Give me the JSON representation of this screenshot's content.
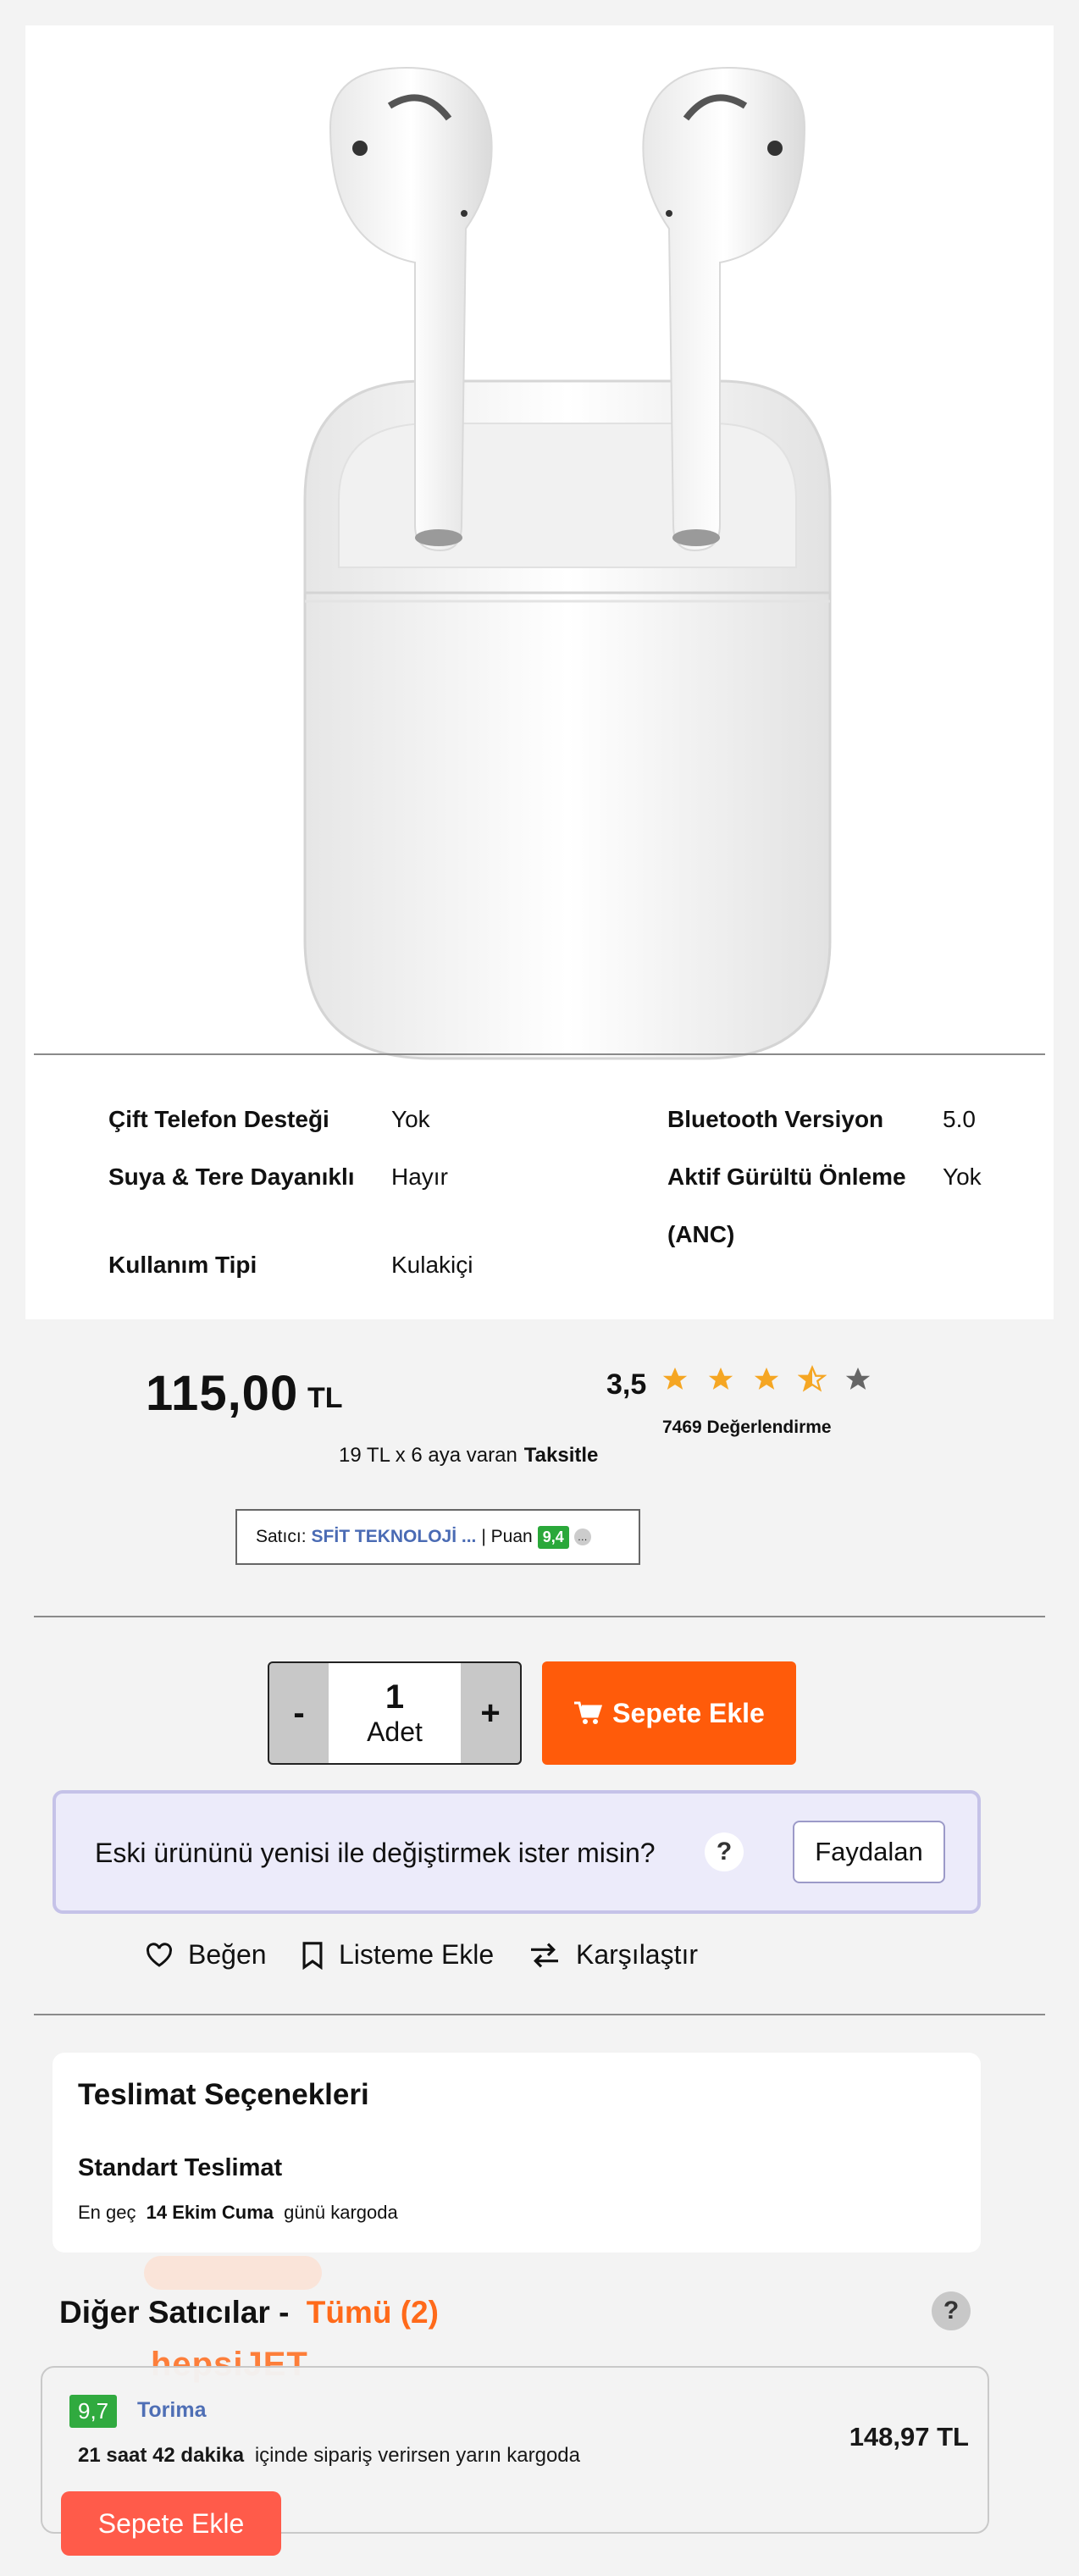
{
  "specs": [
    {
      "label": "Çift Telefon Desteği",
      "value": "Yok"
    },
    {
      "label": "Bluetooth Versiyon",
      "value": "5.0"
    },
    {
      "label": "Suya & Tere Dayanıklı",
      "value": "Hayır"
    },
    {
      "label": "Aktif Gürültü Önleme (ANC)",
      "label_line1": "Aktif Gürültü Önleme",
      "label_line2": "(ANC)",
      "value": "Yok"
    },
    {
      "label": "Kullanım Tipi",
      "value": "Kulakiçi"
    }
  ],
  "price": {
    "amount": "115,00",
    "currency": "TL",
    "installment_text": "19 TL x 6 aya varan",
    "installment_link": "Taksitle"
  },
  "rating": {
    "score": "3,5",
    "stars": 3.5,
    "count_text": "7469 Değerlendirme",
    "star_color": "#f5a623"
  },
  "seller": {
    "prefix": "Satıcı:",
    "name": "SFİT TEKNOLOJİ ...",
    "separator": "| Puan",
    "score": "9,4"
  },
  "cart": {
    "minus": "-",
    "plus": "+",
    "quantity": "1",
    "unit": "Adet",
    "add_label": "Sepete Ekle",
    "accent": "#ff5b0a"
  },
  "trade_in": {
    "text": "Eski ürününü yenisi ile değiştirmek ister misin?",
    "help": "?",
    "button": "Faydalan"
  },
  "actions": [
    {
      "label": "Beğen",
      "icon": "heart-icon"
    },
    {
      "label": "Listeme Ekle",
      "icon": "bookmark-icon"
    },
    {
      "label": "Karşılaştır",
      "icon": "compare-icon"
    }
  ],
  "delivery": {
    "title": "Teslimat Seçenekleri",
    "option": "Standart Teslimat",
    "prefix": "En geç",
    "date": "14 Ekim Cuma",
    "suffix": "günü kargoda"
  },
  "other_sellers": {
    "title": "Diğer Satıcılar -",
    "all_link": "Tümü (2)",
    "help": "?",
    "faded_logo": "hepsiJET",
    "card": {
      "score": "9,7",
      "name": "Torima",
      "time_bold": "21 saat 42 dakika",
      "time_text": "içinde sipariş verirsen yarın kargoda",
      "price": "148,97 TL",
      "button": "Sepete Ekle"
    }
  }
}
